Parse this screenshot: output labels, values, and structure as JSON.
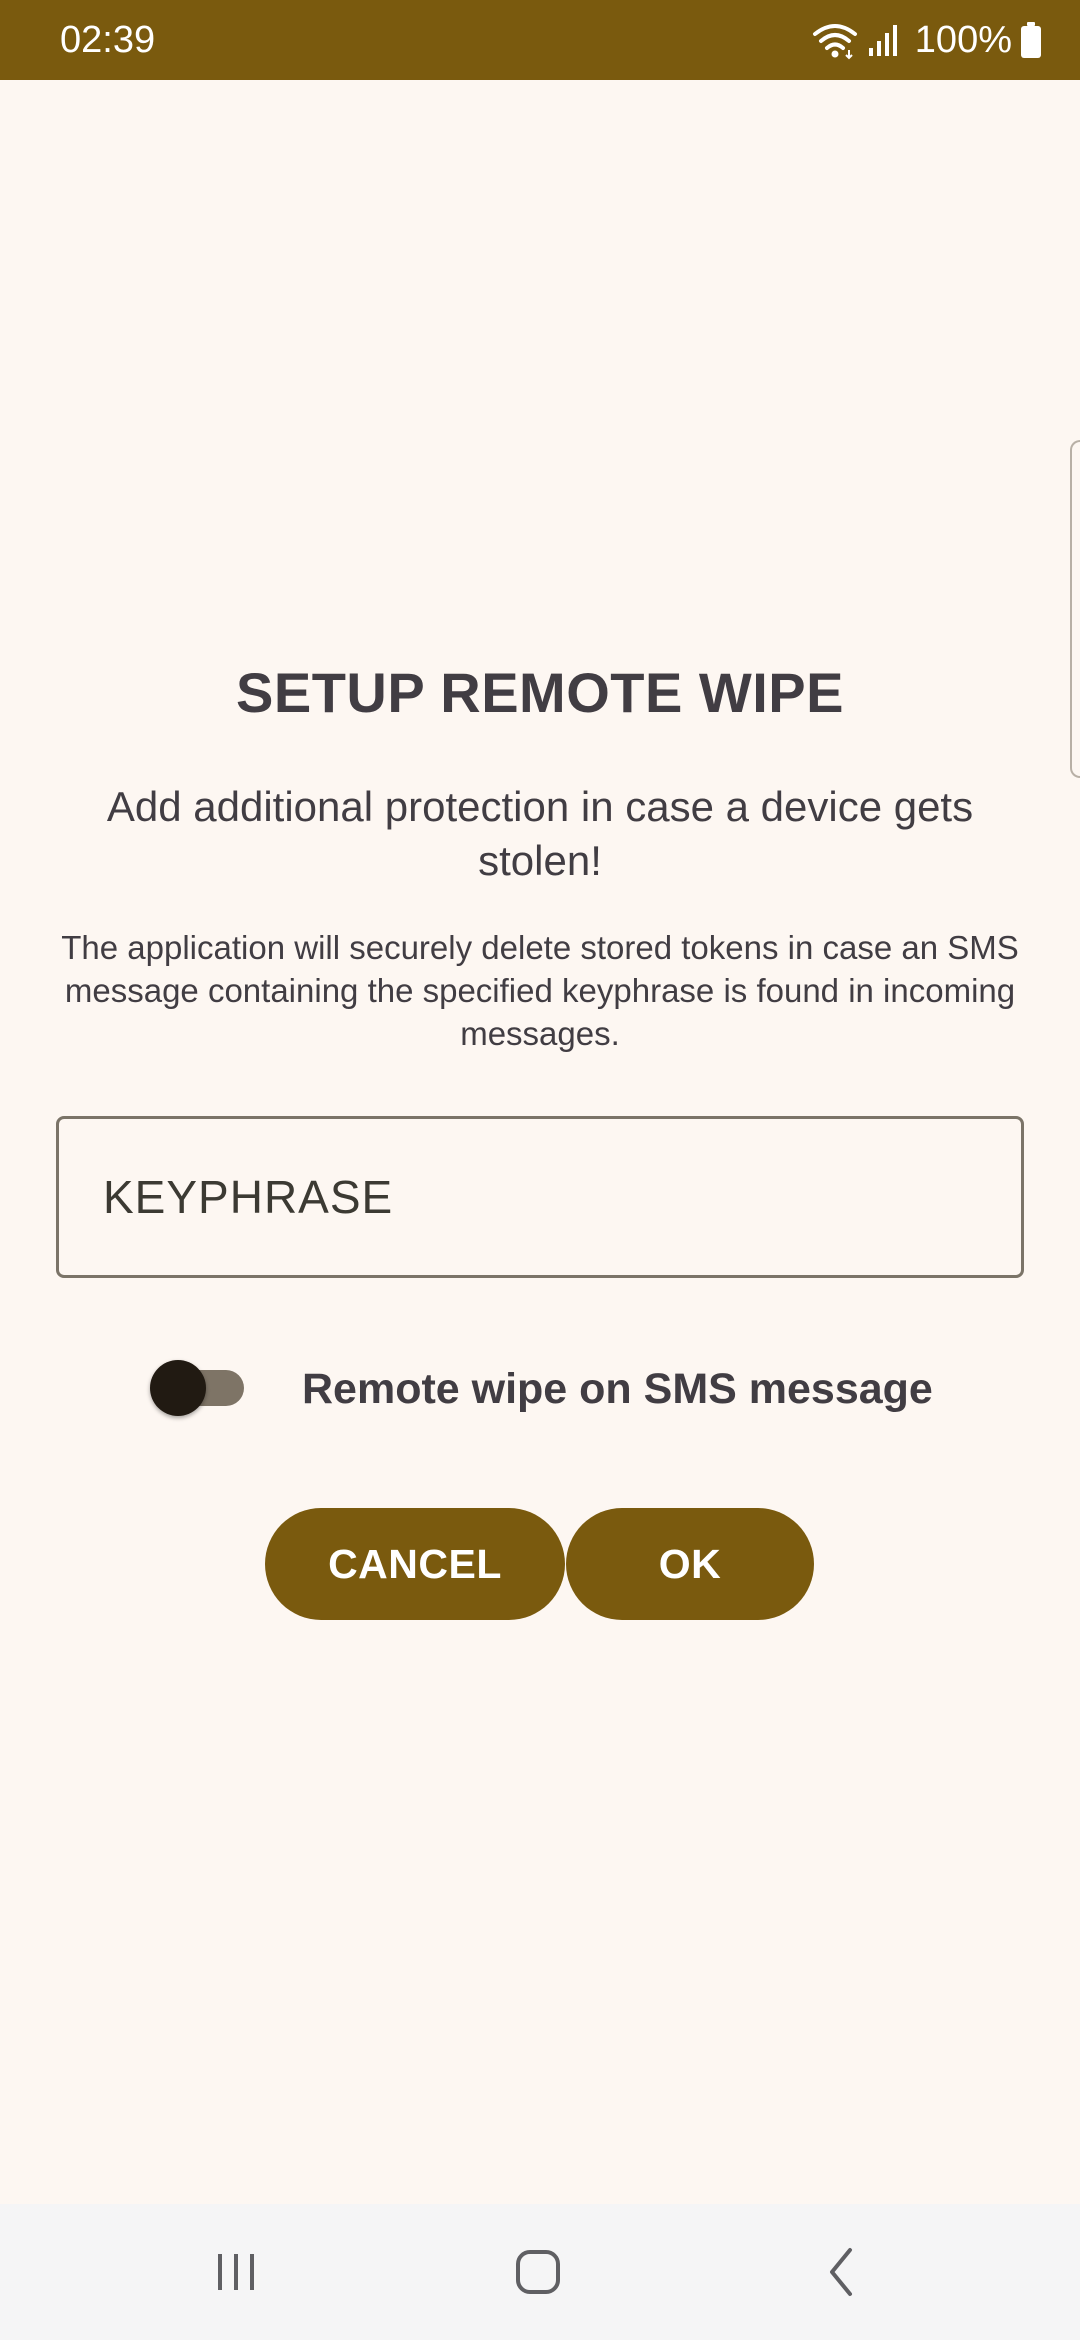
{
  "status_bar": {
    "time": "02:39",
    "battery": "100%",
    "icons": [
      "wifi-icon",
      "signal-icon",
      "battery-icon"
    ],
    "background_color": "#7a5a0e"
  },
  "dialog": {
    "title": "SETUP REMOTE WIPE",
    "subtitle": "Add additional protection in case a device gets stolen!",
    "description": "The application will securely delete stored tokens in case an SMS message containing the specified keyphrase is found in incoming messages.",
    "keyphrase_placeholder": "KEYPHRASE",
    "keyphrase_value": "",
    "toggle_label": "Remote wipe on SMS message",
    "toggle_on": false,
    "cancel_label": "CANCEL",
    "ok_label": "OK",
    "accent_color": "#7a5a0e"
  },
  "nav_bar": {
    "icons": [
      "recents-icon",
      "home-icon",
      "back-icon"
    ]
  }
}
